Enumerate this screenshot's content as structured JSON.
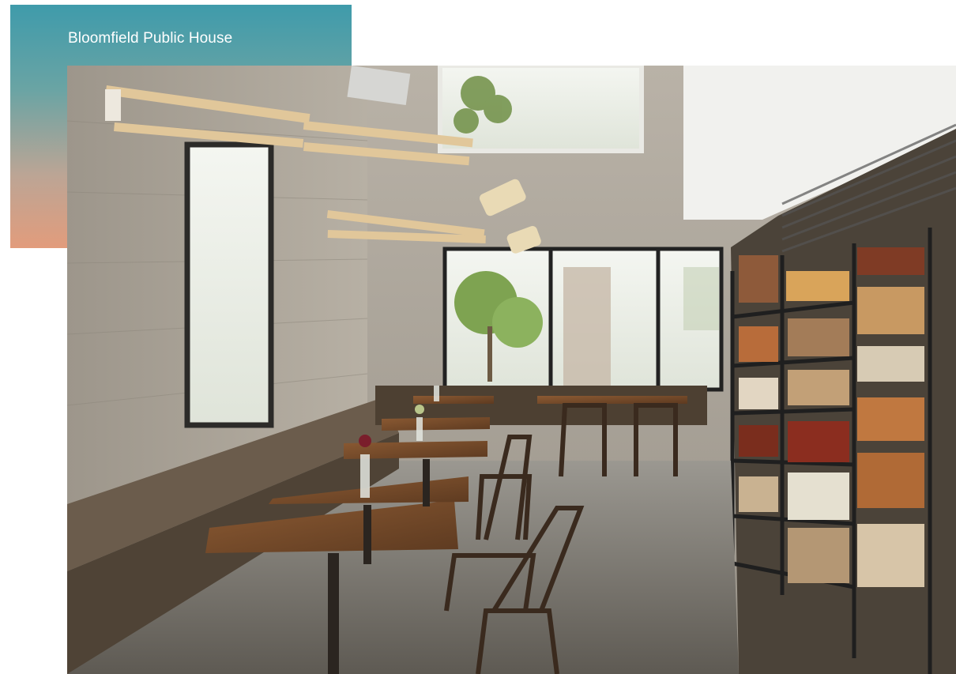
{
  "brand": {
    "title": "Bloomfield Public House"
  },
  "hero_image": {
    "subject": "cafe-interior-photo",
    "palette": {
      "title_card_top": "#3f9bab",
      "title_card_bottom": "#e29c7c",
      "title_text": "#ffffff"
    }
  }
}
